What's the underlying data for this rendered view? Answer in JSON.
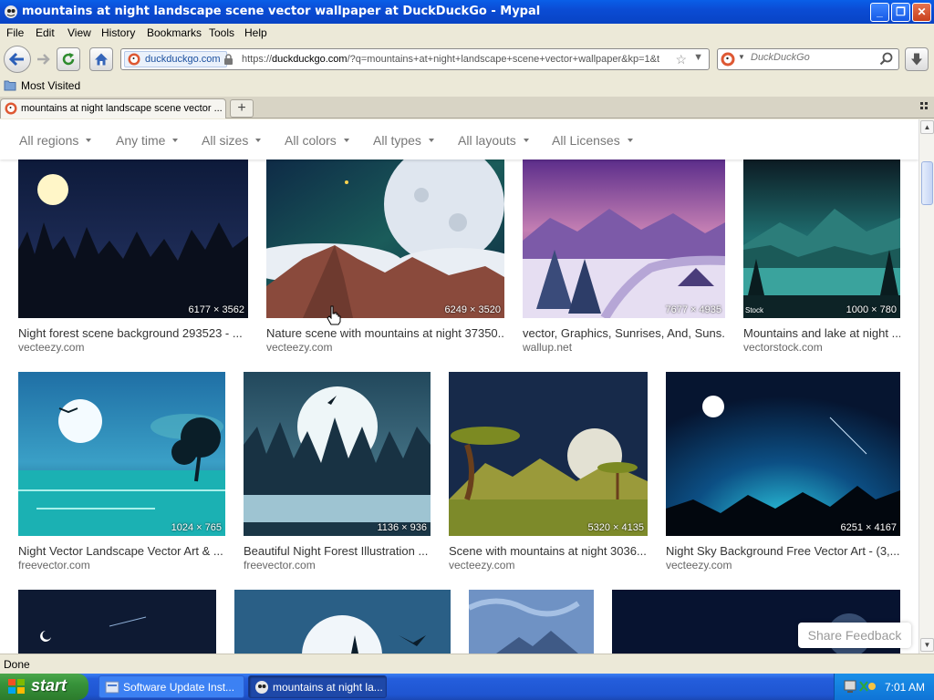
{
  "window": {
    "title": "mountains at night landscape scene vector wallpaper at DuckDuckGo - Mypal",
    "minimize_label": "_",
    "maximize_label": "❐",
    "close_label": "✕"
  },
  "menu": [
    "File",
    "Edit",
    "View",
    "History",
    "Bookmarks",
    "Tools",
    "Help"
  ],
  "nav": {
    "site_identity": "duckduckgo.com",
    "url_prefix": "https://",
    "url_host": "duckduckgo.com",
    "url_rest": "/?q=mountains+at+night+landscape+scene+vector+wallpaper&kp=1&t",
    "search_placeholder": "DuckDuckGo"
  },
  "bookmarks": {
    "most_visited": "Most Visited"
  },
  "tab": {
    "title": "mountains at night landscape scene vector ...",
    "new_tab": "+"
  },
  "filters": [
    "All regions",
    "Any time",
    "All sizes",
    "All colors",
    "All types",
    "All layouts",
    "All Licenses"
  ],
  "results": [
    {
      "title": "Night forest scene background 293523 - ...",
      "source": "vecteezy.com",
      "dims": "6177 × 3562"
    },
    {
      "title": "Nature scene with mountains at night 37350...",
      "source": "vecteezy.com",
      "dims": "6249 × 3520"
    },
    {
      "title": "vector, Graphics, Sunrises, And, Suns...",
      "source": "wallup.net",
      "dims": "7677 × 4935"
    },
    {
      "title": "Mountains and lake at night ...",
      "source": "vectorstock.com",
      "dims": "1000 × 780",
      "watermark": "Stock"
    },
    {
      "title": "Night Vector Landscape Vector Art & ...",
      "source": "freevector.com",
      "dims": "1024 × 765"
    },
    {
      "title": "Beautiful Night Forest Illustration ...",
      "source": "freevector.com",
      "dims": "1136 × 936"
    },
    {
      "title": "Scene with mountains at night 3036...",
      "source": "vecteezy.com",
      "dims": "5320 × 4135"
    },
    {
      "title": "Night Sky Background Free Vector Art - (3,...",
      "source": "vecteezy.com",
      "dims": "6251 × 4167"
    }
  ],
  "feedback": "Share Feedback",
  "status": "Done",
  "taskbar": {
    "start": "start",
    "tasks": [
      "Software Update Inst...",
      "mountains at night la..."
    ],
    "clock": "7:01 AM"
  }
}
